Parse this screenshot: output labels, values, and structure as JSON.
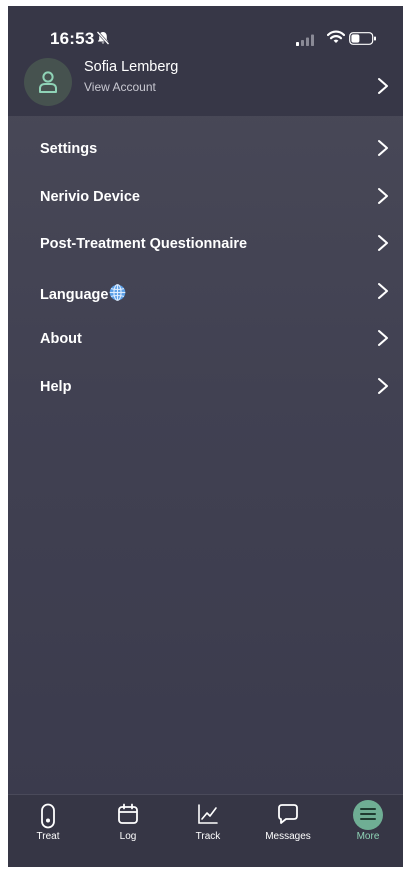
{
  "status_bar": {
    "time": "16:53",
    "icons": [
      "bell-slash-icon",
      "signal-icon",
      "wifi-icon",
      "battery-icon"
    ]
  },
  "account": {
    "name": "Sofia Lemberg",
    "subtitle": "View Account",
    "icon": "user-icon"
  },
  "menu": {
    "items": [
      {
        "label": "Settings"
      },
      {
        "label": "Nerivio Device"
      },
      {
        "label": "Post-Treatment Questionnaire"
      },
      {
        "label": "Language",
        "icon": "globe-icon"
      },
      {
        "label": "About"
      },
      {
        "label": "Help"
      }
    ]
  },
  "tabbar": {
    "tabs": [
      {
        "label": "Treat",
        "icon": "device-icon"
      },
      {
        "label": "Log",
        "icon": "calendar-icon"
      },
      {
        "label": "Track",
        "icon": "chart-icon"
      },
      {
        "label": "Messages",
        "icon": "chat-bubble-icon"
      },
      {
        "label": "More",
        "icon": "menu-lines-icon",
        "active": true
      }
    ]
  },
  "colors": {
    "background": "#414152",
    "header": "#373747",
    "accent": "#6fae94",
    "accent_text": "#8fd3b6",
    "text": "#ffffff"
  }
}
